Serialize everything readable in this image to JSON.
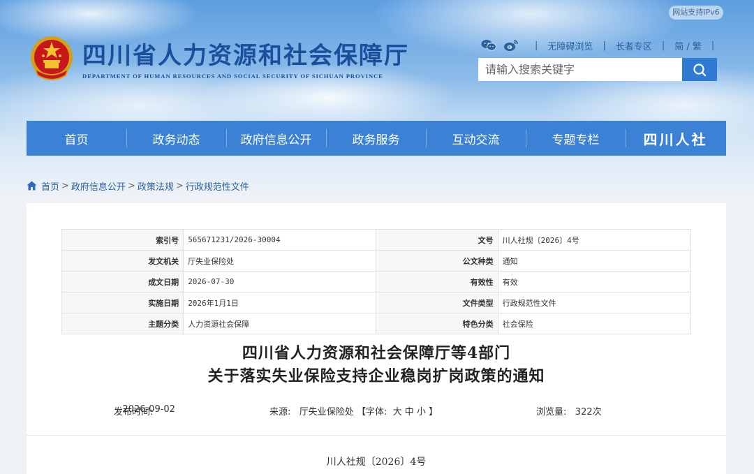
{
  "header": {
    "ipv6_badge": "网站支持IPv6",
    "site_title": "四川省人力资源和社会保障厅",
    "site_subtitle": "DEPARTMENT OF HUMAN RESOURCES AND SOCIAL SECURITY OF SICHUAN PROVINCE",
    "util_links": {
      "accessibility": "无障碍浏览",
      "elderly": "长者专区",
      "lang": "简 / 繁",
      "sep": "|"
    },
    "search": {
      "placeholder": "请输入搜索关键字"
    }
  },
  "nav": {
    "items": [
      "首页",
      "政务动态",
      "政府信息公开",
      "政务服务",
      "互动交流",
      "专题专栏"
    ],
    "brand": "四川人社"
  },
  "breadcrumb": {
    "items": [
      "首页",
      "政府信息公开",
      "政策法规",
      "行政规范性文件"
    ],
    "sep": ">"
  },
  "meta_table": {
    "rows": [
      {
        "k1": "索引号",
        "v1": "565671231/2026-30004",
        "k2": "文号",
        "v2": "川人社规〔2026〕4号"
      },
      {
        "k1": "发文机关",
        "v1": "厅失业保险处",
        "k2": "公文种类",
        "v2": "通知"
      },
      {
        "k1": "成文日期",
        "v1": "2026-07-30",
        "k2": "有效性",
        "v2": "有效"
      },
      {
        "k1": "实施日期",
        "v1": "2026年1月1日",
        "k2": "文件类型",
        "v2": "行政规范性文件"
      },
      {
        "k1": "主题分类",
        "v1": "人力资源社会保障",
        "k2": "特色分类",
        "v2": "社会保险"
      }
    ]
  },
  "document": {
    "title_line1": "四川省人力资源和社会保障厅等4部门",
    "title_line2": "关于落实失业保险支持企业稳岗扩岗政策的通知",
    "publish_label": "发布时间:",
    "publish_date": "2026-09-02",
    "source_label": "来源:",
    "source": "厅失业保险处",
    "font_open": "【字体:",
    "font_large": "大",
    "font_medium": "中",
    "font_small": "小",
    "font_close": "】",
    "views_label": "浏览量:",
    "views": "322次",
    "doc_number": "川人社规〔2026〕4号"
  }
}
